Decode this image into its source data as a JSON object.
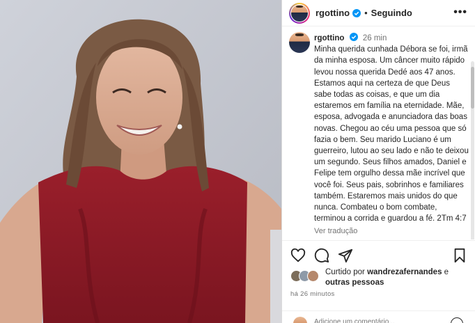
{
  "post": {
    "username": "rgottino",
    "follow_status": "Seguindo",
    "time": "26 min",
    "caption": "Minha querida cunhada Débora se foi, irmã da minha esposa. Um câncer muito rápido levou nossa querida Dedé aos 47 anos. Estamos aqui na certeza de que Deus sabe todas as coisas, e que um dia estaremos em família na eternidade. Mãe, esposa, advogada e anunciadora das boas novas. Chegou ao céu uma pessoa que só fazia o bem. Seu marido Luciano é um guerreiro, lutou ao seu lado e não te deixou um segundo. Seus filhos amados, Daniel e Felipe tem orgulho dessa mãe incrível que você foi. Seus pais, sobrinhos e familiares também. Estaremos mais unidos do que nunca. Combateu o bom combate, terminou a corrida e guardou a fé. 2Tm 4:7",
    "translate_label": "Ver tradução"
  },
  "likes": {
    "prefix": "Curtido por ",
    "first_liker": "wandrezafernandes",
    "connector": " e",
    "others": "outras pessoas"
  },
  "timestamp": "há 26 minutos",
  "comment": {
    "placeholder": "Adicione um comentário..."
  },
  "icons": {
    "more": "more-options-icon",
    "verified": "verified-badge-icon",
    "like": "heart-icon",
    "comment": "comment-bubble-icon",
    "share": "paper-plane-icon",
    "save": "bookmark-icon",
    "emoji": "emoji-icon"
  },
  "colors": {
    "verified": "#0095f6",
    "text": "#262626",
    "muted": "#737373",
    "dress": "#8c1b24"
  }
}
